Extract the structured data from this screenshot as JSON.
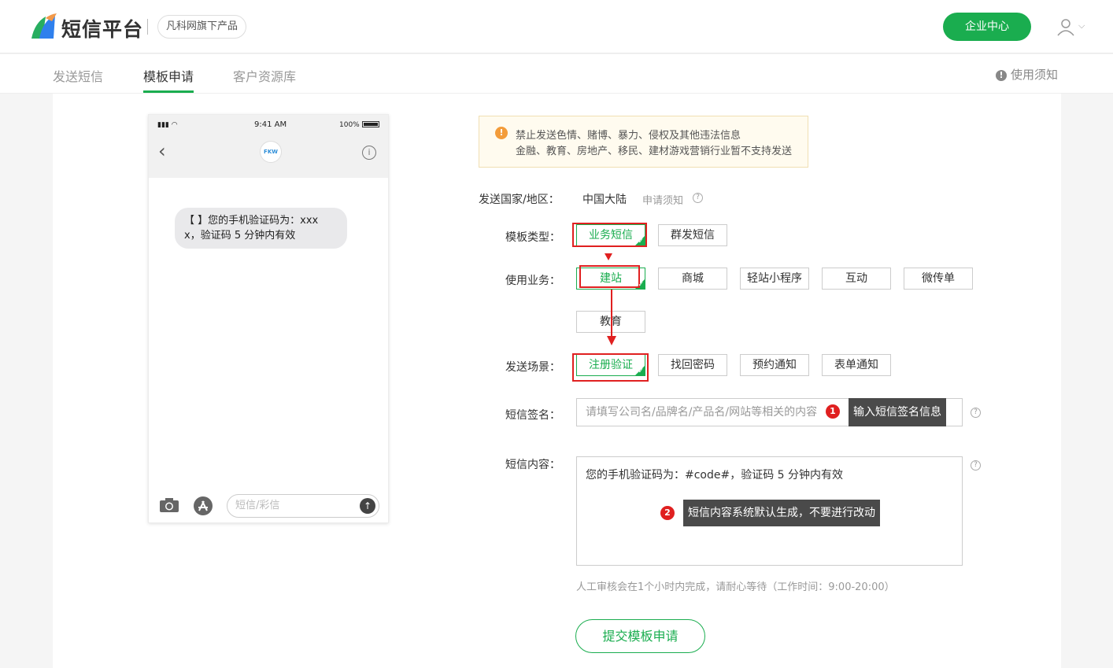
{
  "header": {
    "logo_text": "短信平台",
    "brand_tag": "凡科网旗下产品",
    "enterprise_button": "企业中心"
  },
  "nav": {
    "tabs": [
      "发送短信",
      "模板申请",
      "客户资源库"
    ],
    "active_tab": "模板申请",
    "notice": "使用须知"
  },
  "phone": {
    "time": "9:41 AM",
    "battery": "100%",
    "avatar": "FKW",
    "message": "【 】您的手机验证码为：xxx x，验证码 5 分钟内有效",
    "input_placeholder": "短信/彩信"
  },
  "warning": {
    "line1": "禁止发送色情、赌博、暴力、侵权及其他违法信息",
    "line2": "金融、教育、房地产、移民、建材游戏营销行业暂不支持发送"
  },
  "form": {
    "country_label": "发送国家/地区：",
    "country_value": "中国大陆",
    "country_note": "申请须知",
    "type_label": "模板类型：",
    "type_options": [
      "业务短信",
      "群发短信"
    ],
    "type_selected": "业务短信",
    "business_label": "使用业务：",
    "business_options": [
      "建站",
      "商城",
      "轻站小程序",
      "互动",
      "微传单",
      "教育"
    ],
    "business_selected": "建站",
    "scene_label": "发送场景：",
    "scene_options": [
      "注册验证",
      "找回密码",
      "预约通知",
      "表单通知"
    ],
    "scene_selected": "注册验证",
    "sign_label": "短信签名：",
    "sign_placeholder": "请填写公司名/品牌名/产品名/网站等相关的内容",
    "sign_tip": "输入短信签名信息",
    "sign_tip_num": "1",
    "content_label": "短信内容：",
    "content_value": "您的手机验证码为：#code#，验证码 5 分钟内有效",
    "content_tip": "短信内容系统默认生成，不要进行改动",
    "content_tip_num": "2",
    "review_hint": "人工审核会在1个小时内完成，请耐心等待（工作时间：9:00-20:00）",
    "submit_label": "提交模板申请"
  },
  "colors": {
    "accent": "#1aad4f",
    "highlight": "#e02020"
  }
}
